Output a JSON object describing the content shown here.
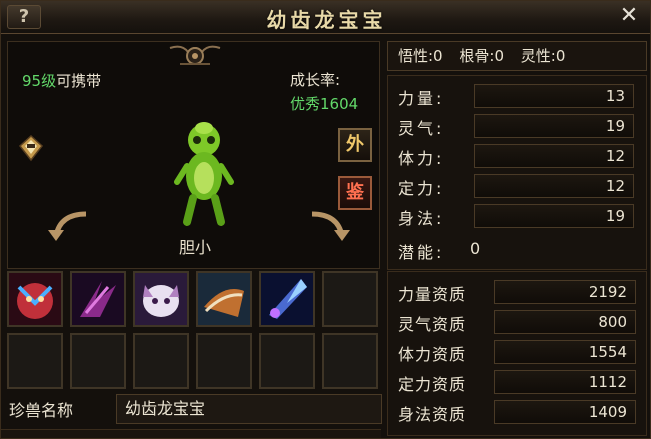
{
  "window": {
    "title": "幼齿龙宝宝",
    "help_label": "?",
    "close_label": "✕"
  },
  "pet": {
    "level_num": "95级",
    "level_suffix": "可携带",
    "growth_label": "成长率:",
    "growth_value": "优秀1604",
    "temperament": "胆小",
    "btn_wai": "外",
    "btn_jian": "鉴"
  },
  "top_stats": {
    "wuxing": "悟性:0",
    "gengu": "根骨:0",
    "lingxing": "灵性:0"
  },
  "attributes": [
    {
      "label": "力量:",
      "value": "13"
    },
    {
      "label": "灵气:",
      "value": "19"
    },
    {
      "label": "体力:",
      "value": "12"
    },
    {
      "label": "定力:",
      "value": "12"
    },
    {
      "label": "身法:",
      "value": "19"
    }
  ],
  "potential": {
    "label": "潜能:",
    "value": "0"
  },
  "aptitudes": [
    {
      "label": "力量资质",
      "value": "2192"
    },
    {
      "label": "灵气资质",
      "value": "800"
    },
    {
      "label": "体力资质",
      "value": "1554"
    },
    {
      "label": "定力资质",
      "value": "1112"
    },
    {
      "label": "身法资质",
      "value": "1409"
    }
  ],
  "name_field": {
    "label": "珍兽名称",
    "value": "幼齿龙宝宝"
  },
  "skills": [
    {
      "icon": "red-beast-skill-icon",
      "color": "#c0303a"
    },
    {
      "icon": "purple-claw-skill-icon",
      "color": "#8a2a8a"
    },
    {
      "icon": "white-beast-skill-icon",
      "color": "#b080c0"
    },
    {
      "icon": "strike-skill-icon",
      "color": "#c07030"
    },
    {
      "icon": "blue-crystal-skill-icon",
      "color": "#4a6ad0"
    }
  ],
  "colors": {
    "accent_green": "#63d96a",
    "text": "#ece5d3",
    "gold": "#f0c86a"
  }
}
